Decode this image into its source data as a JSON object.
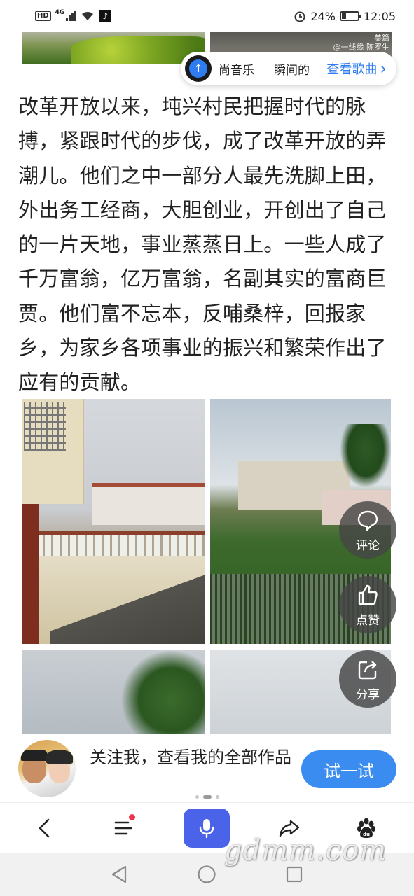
{
  "status_bar": {
    "hd": "HD",
    "network": "4G",
    "battery": "24%",
    "time": "12:05"
  },
  "photo_watermark": {
    "line1": "美篇",
    "line2": "@一线缘 陈罗生"
  },
  "music_pill": {
    "title": "尚音乐",
    "subtitle": "瞬间的",
    "link": "查看歌曲",
    "chevron": "›"
  },
  "article": {
    "paragraph": "改革开放以来，坉兴村民把握时代的脉搏，紧跟时代的步伐，成了改革开放的弄潮儿。他们之中一部分人最先洗脚上田，外出务工经商，大胆创业，开创出了自己的一片天地，事业蒸蒸日上。一些人成了千万富翁，亿万富翁，名副其实的富商巨贾。他们富不忘本，反哺桑梓，回报家乡，为家乡各项事业的振兴和繁荣作出了应有的贡献。"
  },
  "side_actions": {
    "comment": "评论",
    "like": "点赞",
    "share": "分享"
  },
  "follow_banner": {
    "text": "关注我，查看我的全部作品",
    "button": "试一试"
  },
  "watermark": "gdmm.com",
  "colors": {
    "accent": "#3b8cf0",
    "mic": "#4a63e8",
    "badge": "#f2344a"
  }
}
